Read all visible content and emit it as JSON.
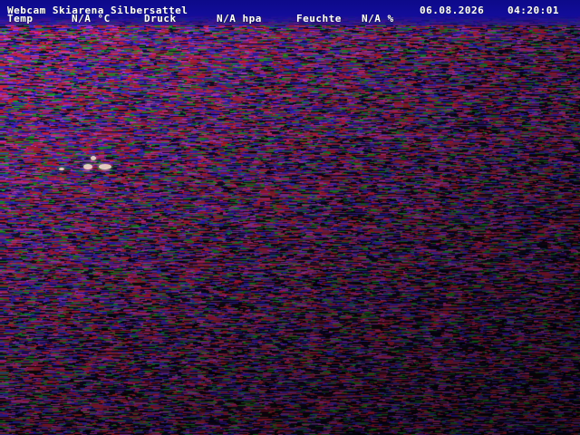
{
  "overlay": {
    "title": "Webcam Skiarena Silbersattel",
    "date": "06.08.2026",
    "time": "04:20:01",
    "temp_label": "Temp",
    "temp_value": "N/A °C",
    "pressure_label": "Druck",
    "pressure_value": "N/A hpa",
    "humidity_label": "Feuchte",
    "humidity_value": "N/A %"
  },
  "colors": {
    "header_band": "#120c9a",
    "text": "#ffffff",
    "noise_red": "#d02030",
    "noise_blue": "#3020d0",
    "noise_green": "#20a030",
    "noise_magenta": "#c030c0"
  }
}
